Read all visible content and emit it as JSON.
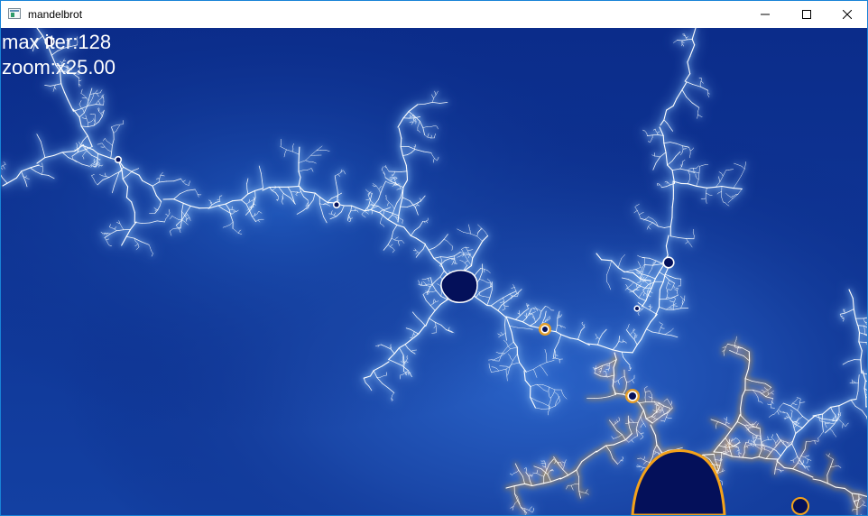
{
  "window": {
    "title": "mandelbrot",
    "icon": "app-window-icon",
    "controls": {
      "minimize_icon": "minimize-icon",
      "maximize_icon": "maximize-icon",
      "close_icon": "close-icon"
    }
  },
  "overlay": {
    "max_iter_text": "max iter:128",
    "zoom_text": "zoom:x25.00"
  },
  "colors": {
    "window_border": "#1883d7",
    "background_deep": "#0a2a86",
    "background_light": "#1b4bb0",
    "filament_core": "#ffffff",
    "filament_glow": "#7fb4f0",
    "hot_filament": "#f4a21a",
    "set_interior": "#04105a"
  }
}
